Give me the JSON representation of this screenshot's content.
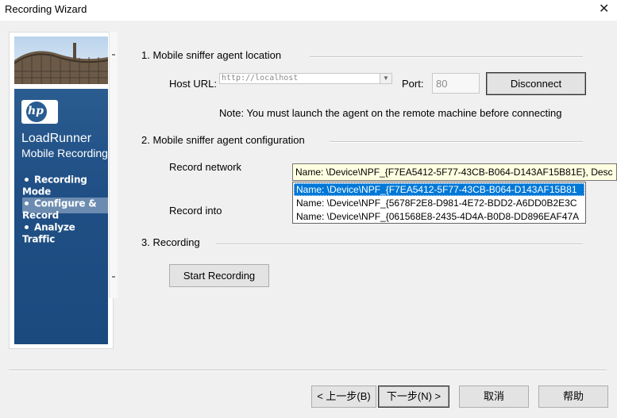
{
  "window": {
    "title": "Recording Wizard",
    "close_glyph": "✕"
  },
  "sidebar": {
    "logo_text": "hp",
    "brand_line1": "LoadRunner",
    "brand_line2": "Mobile Recording",
    "items": [
      {
        "label": "Recording Mode",
        "active": false
      },
      {
        "label": "Configure & Record",
        "active": true
      },
      {
        "label": "Analyze Traffic",
        "active": false
      }
    ]
  },
  "section1": {
    "title": "1.  Mobile sniffer agent location",
    "host_label": "Host URL:",
    "host_value": "http://localhost",
    "port_label": "Port:",
    "port_value": "80",
    "disconnect_label": "Disconnect",
    "note": "Note: You must launch the agent on the remote machine before connecting"
  },
  "section2": {
    "title": "2.  Mobile sniffer agent configuration",
    "record_network_label": "Record network",
    "record_into_label": "Record into",
    "tooltip": "Name: \\Device\\NPF_{F7EA5412-5F77-43CB-B064-D143AF15B81E}, Desc",
    "network_options": [
      "Name: \\Device\\NPF_{F7EA5412-5F77-43CB-B064-D143AF15B81",
      "Name: \\Device\\NPF_{5678F2E8-D981-4E72-BDD2-A6DD0B2E3C",
      "Name: \\Device\\NPF_{061568E8-2435-4D4A-B0D8-DD896EAF47A"
    ],
    "selected_index": 0
  },
  "section3": {
    "title": "3.  Recording",
    "start_label": "Start Recording"
  },
  "footer": {
    "back_label": "< 上一步(B)",
    "next_label": "下一步(N) >",
    "cancel_label": "取消",
    "help_label": "帮助"
  },
  "colors": {
    "selection": "#0078d7",
    "sidebar_blue": "#1f4f84",
    "tooltip_bg": "#ffffe1"
  }
}
